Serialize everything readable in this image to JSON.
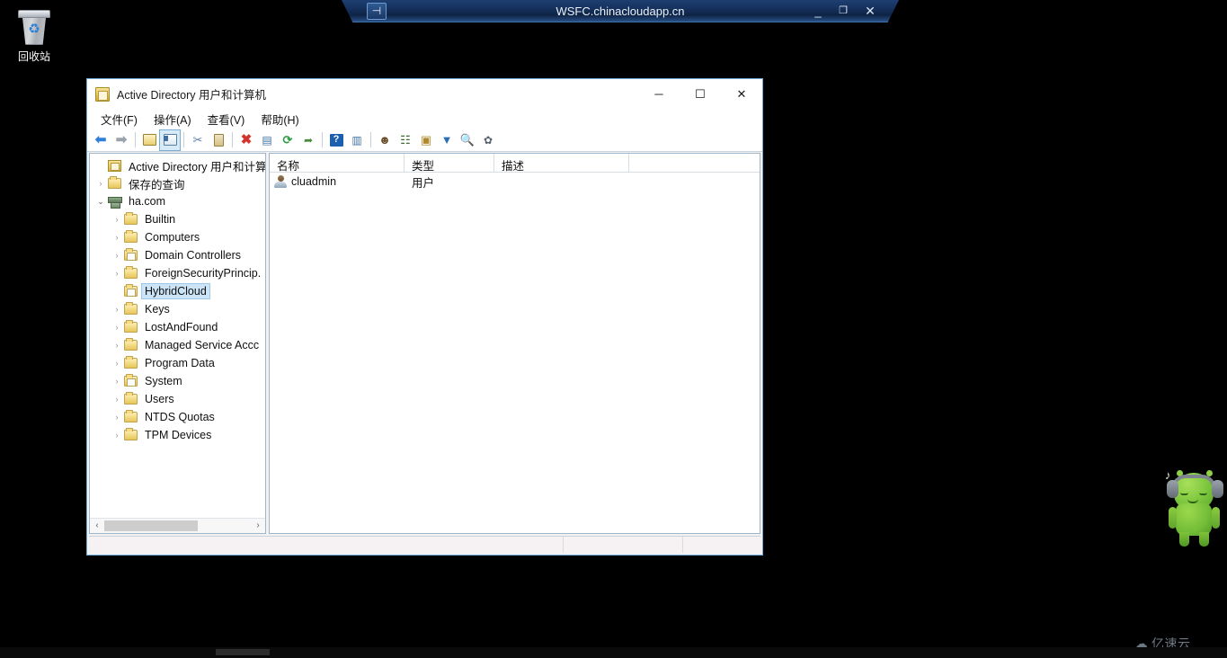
{
  "desktop": {
    "background_color": "#000000",
    "recycle_bin": {
      "label": "回收站",
      "icon": "recycle-bin-icon",
      "recycle_glyph": "♻"
    },
    "mascot": {
      "name": "android-mascot",
      "note_glyph": "♪"
    },
    "watermark": {
      "text": "亿速云",
      "logo_glyph": "☁"
    }
  },
  "rdp_bar": {
    "title": "WSFC.chinacloudapp.cn",
    "pin_icon": "pin-icon",
    "pin_glyph": "⊣",
    "minimize": "_",
    "restore": "❐",
    "close": "✕",
    "accent_color": "#15315c"
  },
  "window": {
    "title": "Active Directory 用户和计算机",
    "icon": "mmc-console-icon",
    "controls": {
      "minimize": "─",
      "maximize": "☐",
      "close": "✕"
    },
    "menu": [
      {
        "label": "文件(F)",
        "name": "menu-file"
      },
      {
        "label": "操作(A)",
        "name": "menu-action"
      },
      {
        "label": "查看(V)",
        "name": "menu-view"
      },
      {
        "label": "帮助(H)",
        "name": "menu-help"
      }
    ],
    "toolbar": [
      {
        "name": "back-button",
        "glyph": "⬅",
        "cls": "ico-arrow-l"
      },
      {
        "name": "forward-button",
        "glyph": "➡",
        "cls": "ico-arrow-r"
      },
      {
        "name": "up-one-level-button",
        "glyph": "",
        "cls": "ico-sq"
      },
      {
        "name": "show-hide-tree-button",
        "glyph": "",
        "cls": "ico-sq win"
      },
      {
        "name": "cut-button",
        "glyph": "✂",
        "cls": "ico-cut"
      },
      {
        "name": "paste-button",
        "glyph": "",
        "cls": "ico-clip"
      },
      {
        "name": "delete-button",
        "glyph": "✖",
        "cls": "ico-x"
      },
      {
        "name": "properties-button",
        "glyph": "▤",
        "cls": "ico-props"
      },
      {
        "name": "refresh-button",
        "glyph": "⟳",
        "cls": "ico-refresh"
      },
      {
        "name": "export-list-button",
        "glyph": "➦",
        "cls": "ico-export"
      },
      {
        "name": "help-button",
        "glyph": "?",
        "cls": "ico-help"
      },
      {
        "name": "console-view-button",
        "glyph": "▥",
        "cls": "ico-props"
      },
      {
        "name": "new-user-button",
        "glyph": "☻",
        "cls": "ico-user-add"
      },
      {
        "name": "new-group-button",
        "glyph": "☷",
        "cls": "ico-grp-add"
      },
      {
        "name": "new-ou-button",
        "glyph": "▣",
        "cls": "ico-ou-add"
      },
      {
        "name": "filter-button",
        "glyph": "▼",
        "cls": "ico-filter"
      },
      {
        "name": "find-button",
        "glyph": "🔍",
        "cls": "ico-find"
      },
      {
        "name": "settings-button",
        "glyph": "✿",
        "cls": "ico-gear"
      }
    ],
    "tree": {
      "nodes": [
        {
          "label": "Active Directory 用户和计算机",
          "level": 0,
          "icon": "console-root-icon",
          "chevron": "",
          "selected": false,
          "name": "tree-item-root"
        },
        {
          "label": "保存的查询",
          "level": 1,
          "icon": "folder-icon",
          "chevron": "›",
          "selected": false,
          "name": "tree-item-saved-queries"
        },
        {
          "label": "ha.com",
          "level": 1,
          "icon": "domain-icon",
          "chevron": "⌄",
          "selected": false,
          "name": "tree-item-ha-com"
        },
        {
          "label": "Builtin",
          "level": 2,
          "icon": "folder-icon",
          "chevron": "›",
          "selected": false,
          "name": "tree-item-builtin"
        },
        {
          "label": "Computers",
          "level": 2,
          "icon": "folder-icon",
          "chevron": "›",
          "selected": false,
          "name": "tree-item-computers"
        },
        {
          "label": "Domain Controllers",
          "level": 2,
          "icon": "folder-special-icon",
          "chevron": "›",
          "selected": false,
          "name": "tree-item-domain-controllers"
        },
        {
          "label": "ForeignSecurityPrincip.",
          "level": 2,
          "icon": "folder-icon",
          "chevron": "›",
          "selected": false,
          "name": "tree-item-foreign-security-principals"
        },
        {
          "label": "HybridCloud",
          "level": 2,
          "icon": "folder-special-icon",
          "chevron": "",
          "selected": true,
          "name": "tree-item-hybridcloud"
        },
        {
          "label": "Keys",
          "level": 2,
          "icon": "folder-icon",
          "chevron": "›",
          "selected": false,
          "name": "tree-item-keys"
        },
        {
          "label": "LostAndFound",
          "level": 2,
          "icon": "folder-icon",
          "chevron": "›",
          "selected": false,
          "name": "tree-item-lostandfound"
        },
        {
          "label": "Managed Service Accc",
          "level": 2,
          "icon": "folder-icon",
          "chevron": "›",
          "selected": false,
          "name": "tree-item-managed-service-accounts"
        },
        {
          "label": "Program Data",
          "level": 2,
          "icon": "folder-icon",
          "chevron": "›",
          "selected": false,
          "name": "tree-item-program-data"
        },
        {
          "label": "System",
          "level": 2,
          "icon": "folder-special-icon",
          "chevron": "›",
          "selected": false,
          "name": "tree-item-system"
        },
        {
          "label": "Users",
          "level": 2,
          "icon": "folder-icon",
          "chevron": "›",
          "selected": false,
          "name": "tree-item-users"
        },
        {
          "label": "NTDS Quotas",
          "level": 2,
          "icon": "folder-icon",
          "chevron": "›",
          "selected": false,
          "name": "tree-item-ntds-quotas"
        },
        {
          "label": "TPM Devices",
          "level": 2,
          "icon": "folder-icon",
          "chevron": "›",
          "selected": false,
          "name": "tree-item-tpm-devices"
        }
      ],
      "hscroll": {
        "left_arrow": "‹",
        "right_arrow": "›"
      },
      "selection_color": "#cce4f7"
    },
    "list": {
      "columns": [
        {
          "label": "名称",
          "name": "column-header-name"
        },
        {
          "label": "类型",
          "name": "column-header-type"
        },
        {
          "label": "描述",
          "name": "column-header-description"
        }
      ],
      "rows": [
        {
          "name": "cluadmin",
          "type": "用户",
          "description": "",
          "icon": "user-icon"
        }
      ]
    },
    "status_bar": {
      "left": "",
      "middle": "",
      "right": ""
    }
  },
  "taskbar": {
    "visible": true
  }
}
